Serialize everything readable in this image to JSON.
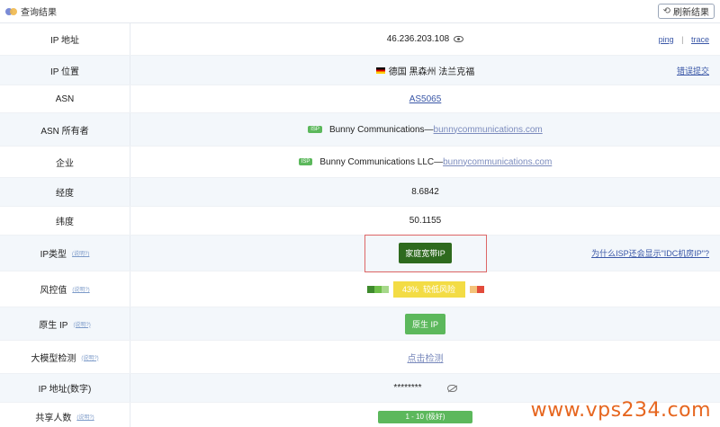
{
  "header": {
    "title": "查询结果",
    "refresh_label": "刷新结果",
    "refresh_icon": "refresh-icon"
  },
  "rows": {
    "ip": {
      "label": "IP 地址",
      "value": "46.236.203.108",
      "ping": "ping",
      "sep": "|",
      "trace": "trace"
    },
    "location": {
      "label": "IP 位置",
      "value": "德国 黑森州 法兰克福",
      "report": "错误提交"
    },
    "asn": {
      "label": "ASN",
      "value": "AS5065"
    },
    "asn_owner": {
      "label": "ASN 所有者",
      "tag": "ISP",
      "name": "Bunny Communications—",
      "domain": "bunnycommunications.com"
    },
    "company": {
      "label": "企业",
      "tag": "ISP",
      "name": "Bunny Communications LLC—",
      "domain": "bunnycommunications.com"
    },
    "longitude": {
      "label": "经度",
      "value": "8.6842"
    },
    "latitude": {
      "label": "纬度",
      "value": "50.1155"
    },
    "ip_type": {
      "label": "IP类型",
      "how": "(说明?)",
      "value": "家庭宽带IP",
      "question": "为什么ISP还会显示\"IDC机房IP\"?"
    },
    "risk": {
      "label": "风控值",
      "how": "(说明?)",
      "value": "43%",
      "level": "较低风险",
      "segment_colors": [
        "#3e8a2c",
        "#6fbf4a",
        "#a6d88a",
        "#f4c37a",
        "#e24b3b"
      ]
    },
    "native": {
      "label": "原生 IP",
      "how": "(说明?)",
      "value": "原生 IP"
    },
    "llm": {
      "label": "大模型检测",
      "how": "(说明?)",
      "value": "点击检测"
    },
    "ip_number": {
      "label": "IP 地址(数字)",
      "value": "********"
    },
    "shared": {
      "label": "共享人数",
      "how": "(说明?)",
      "value": "1 - 10 (极好)"
    }
  },
  "watermark": "www.vps234.com"
}
